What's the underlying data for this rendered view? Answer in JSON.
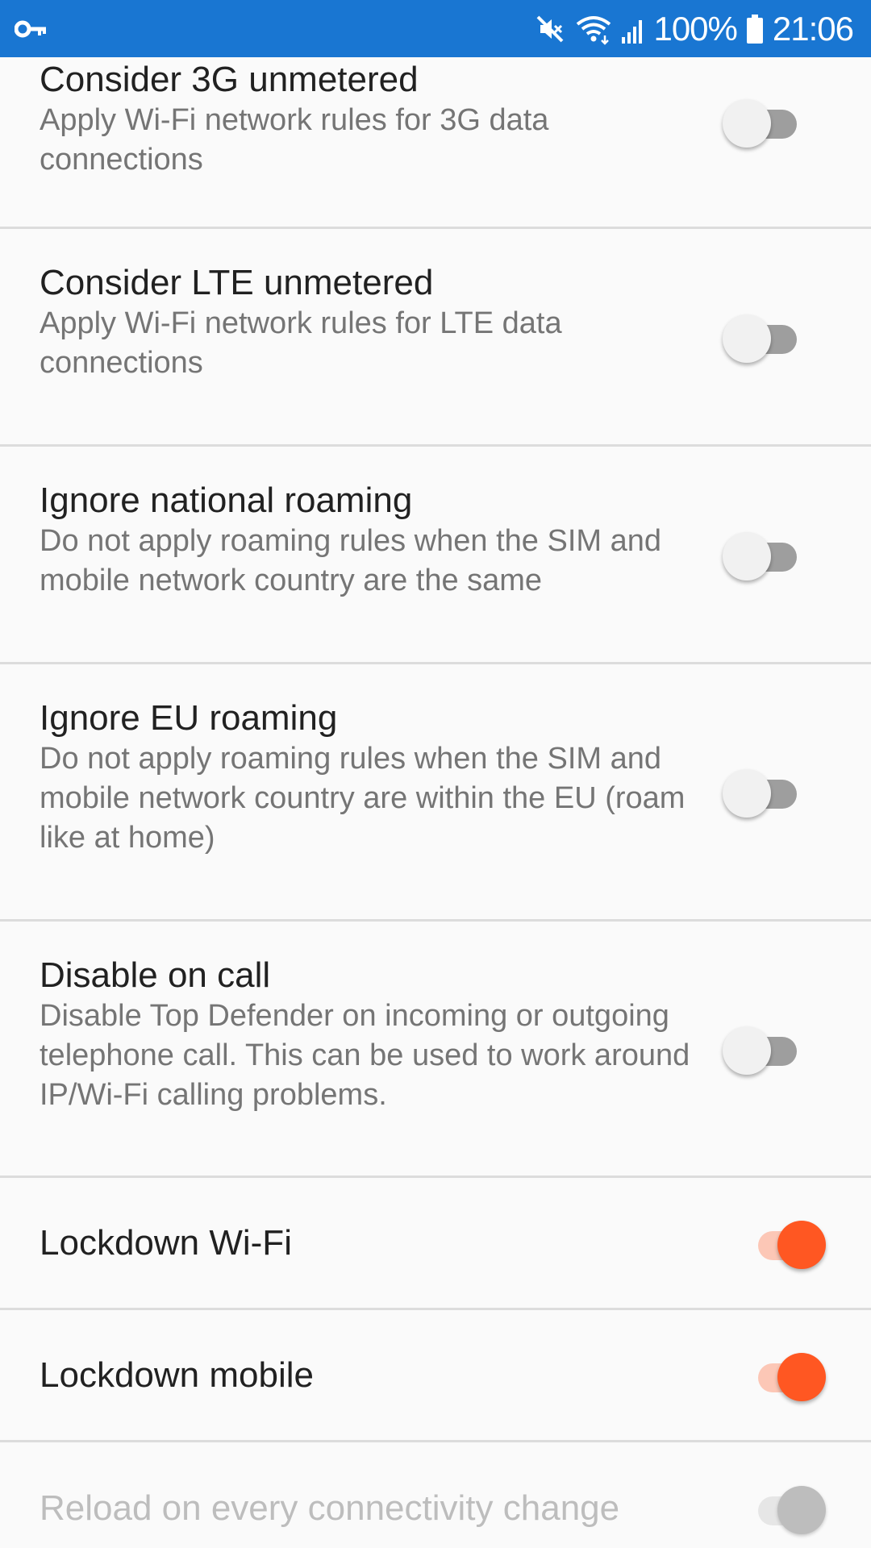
{
  "status_bar": {
    "icons": [
      "vpn-key-icon",
      "mute-icon",
      "wifi-icon",
      "signal-icon",
      "battery-icon"
    ],
    "battery": "100%",
    "time": "21:06",
    "background": "#1976d2"
  },
  "settings": [
    {
      "title": "Consider 3G unmetered",
      "summary": "Apply Wi-Fi network rules for 3G data connections",
      "checked": false,
      "enabled": true
    },
    {
      "title": "Consider LTE unmetered",
      "summary": "Apply Wi-Fi network rules for LTE data connections",
      "checked": false,
      "enabled": true
    },
    {
      "title": "Ignore national roaming",
      "summary": "Do not apply roaming rules when the SIM and mobile network country are the same",
      "checked": false,
      "enabled": true
    },
    {
      "title": "Ignore EU roaming",
      "summary": "Do not apply roaming rules when the SIM and mobile network country are within the EU (roam like at home)",
      "checked": false,
      "enabled": true
    },
    {
      "title": "Disable on call",
      "summary": "Disable Top Defender on incoming or outgoing telephone call. This can be used to work around IP/Wi-Fi calling problems.",
      "checked": false,
      "enabled": true
    },
    {
      "title": "Lockdown Wi-Fi",
      "checked": true,
      "enabled": true
    },
    {
      "title": "Lockdown mobile",
      "checked": true,
      "enabled": true
    },
    {
      "title": "Reload on every connectivity change",
      "checked": true,
      "enabled": false
    }
  ],
  "colors": {
    "accent": "#ff5722",
    "accent_track": "#fcc7b6",
    "title_text": "#212121",
    "summary_text": "#757575",
    "divider": "#dcdcdc"
  }
}
